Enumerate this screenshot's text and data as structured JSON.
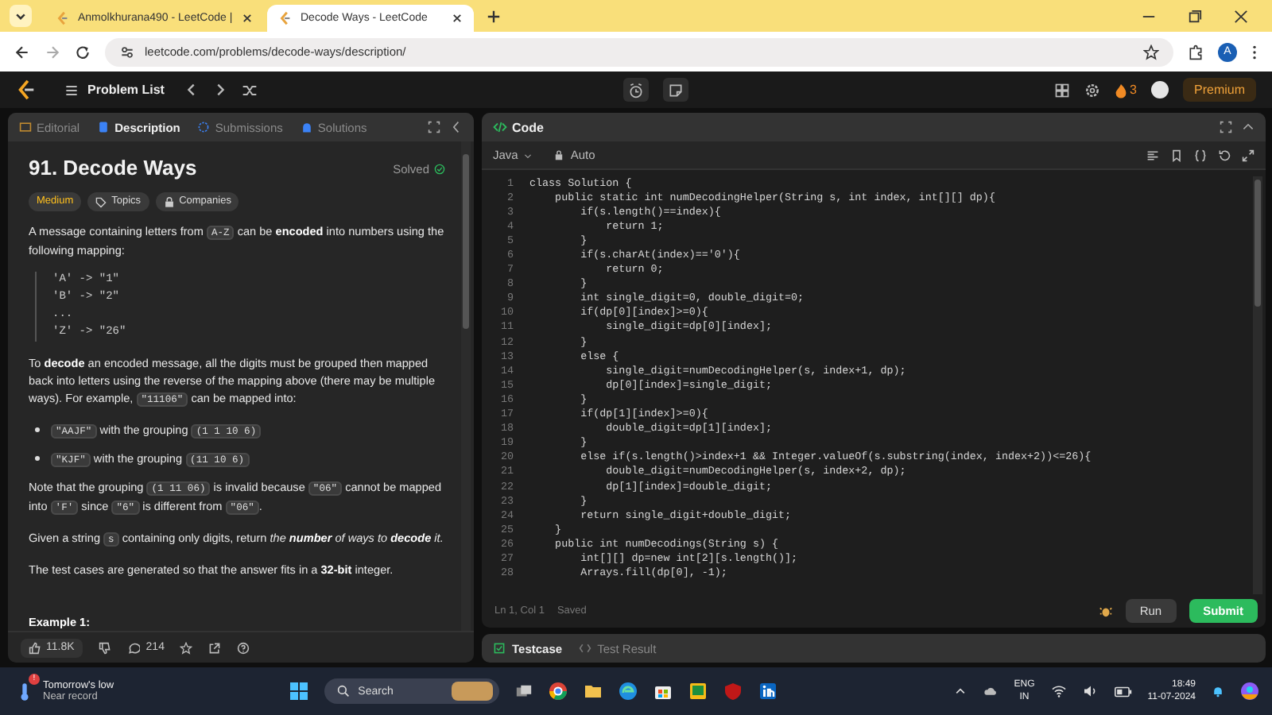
{
  "browser": {
    "tabs": [
      {
        "title": "Anmolkhurana490 - LeetCode |",
        "selected": false
      },
      {
        "title": "Decode Ways - LeetCode",
        "selected": true
      }
    ],
    "url": "leetcode.com/problems/decode-ways/description/",
    "profile_initial": "A"
  },
  "nav": {
    "problem_list": "Problem List",
    "streak": "3",
    "premium": "Premium"
  },
  "left_tabs": [
    {
      "label": "Editorial",
      "selected": false
    },
    {
      "label": "Description",
      "selected": true
    },
    {
      "label": "Submissions",
      "selected": false
    },
    {
      "label": "Solutions",
      "selected": false
    }
  ],
  "problem": {
    "title": "91. Decode Ways",
    "status": "Solved",
    "difficulty": "Medium",
    "tags": [
      "Topics",
      "Companies"
    ],
    "blocks": [
      {
        "kind": "paragraph",
        "parts": [
          {
            "text": "A message containing letters from ",
            "kind": "text"
          },
          {
            "text": "A-Z",
            "kind": "code"
          },
          {
            "text": " can be ",
            "kind": "text"
          },
          {
            "text": "encoded",
            "kind": "bold"
          },
          {
            "text": " into numbers using the following mapping:",
            "kind": "text"
          }
        ]
      },
      {
        "kind": "pre",
        "lines": [
          "'A' -> \"1\"",
          "'B' -> \"2\"",
          "...",
          "'Z' -> \"26\""
        ]
      },
      {
        "kind": "paragraph",
        "parts": [
          {
            "text": "To ",
            "kind": "text"
          },
          {
            "text": "decode",
            "kind": "bold"
          },
          {
            "text": " an encoded message, all the digits must be grouped then mapped back into letters using the reverse of the mapping above (there may be multiple ways). For example, ",
            "kind": "text"
          },
          {
            "text": "\"11106\"",
            "kind": "code"
          },
          {
            "text": " can be mapped into:",
            "kind": "text"
          }
        ]
      },
      {
        "kind": "bullets",
        "items": [
          [
            {
              "text": "\"AAJF\"",
              "kind": "code"
            },
            {
              "text": " with the grouping ",
              "kind": "text"
            },
            {
              "text": "(1 1 10 6)",
              "kind": "code"
            }
          ],
          [
            {
              "text": "\"KJF\"",
              "kind": "code"
            },
            {
              "text": " with the grouping ",
              "kind": "text"
            },
            {
              "text": "(11 10 6)",
              "kind": "code"
            }
          ]
        ]
      },
      {
        "kind": "paragraph",
        "parts": [
          {
            "text": "Note that the grouping ",
            "kind": "text"
          },
          {
            "text": "(1 11 06)",
            "kind": "code"
          },
          {
            "text": " is invalid because ",
            "kind": "text"
          },
          {
            "text": "\"06\"",
            "kind": "code"
          },
          {
            "text": " cannot be mapped into ",
            "kind": "text"
          },
          {
            "text": "'F'",
            "kind": "code"
          },
          {
            "text": " since ",
            "kind": "text"
          },
          {
            "text": "\"6\"",
            "kind": "code"
          },
          {
            "text": " is different from ",
            "kind": "text"
          },
          {
            "text": "\"06\"",
            "kind": "code"
          },
          {
            "text": ".",
            "kind": "text"
          }
        ]
      },
      {
        "kind": "paragraph",
        "parts": [
          {
            "text": "Given a string ",
            "kind": "text"
          },
          {
            "text": "s",
            "kind": "code"
          },
          {
            "text": " containing only digits, return ",
            "kind": "text"
          },
          {
            "text": "the ",
            "kind": "italic"
          },
          {
            "text": "number",
            "kind": "bolditalic"
          },
          {
            "text": " of ways to ",
            "kind": "italic"
          },
          {
            "text": "decode",
            "kind": "bolditalic"
          },
          {
            "text": " it.",
            "kind": "italic"
          }
        ]
      },
      {
        "kind": "paragraph",
        "parts": [
          {
            "text": "The test cases are generated so that the answer fits in a ",
            "kind": "text"
          },
          {
            "text": "32-bit",
            "kind": "bold"
          },
          {
            "text": " integer.",
            "kind": "text"
          }
        ]
      },
      {
        "kind": "heading",
        "text": "Example 1:"
      }
    ]
  },
  "left_footer": {
    "likes": "11.8K",
    "comments": "214"
  },
  "code_panel": {
    "title": "Code",
    "language": "Java",
    "mode": "Auto",
    "lines": [
      {
        "number": "1",
        "text": "class Solution {"
      },
      {
        "number": "2",
        "text": "    public static int numDecodingHelper(String s, int index, int[][] dp){"
      },
      {
        "number": "3",
        "text": "        if(s.length()==index){"
      },
      {
        "number": "4",
        "text": "            return 1;"
      },
      {
        "number": "5",
        "text": "        }"
      },
      {
        "number": "6",
        "text": "        if(s.charAt(index)=='0'){"
      },
      {
        "number": "7",
        "text": "            return 0;"
      },
      {
        "number": "8",
        "text": "        }"
      },
      {
        "number": "9",
        "text": "        int single_digit=0, double_digit=0;"
      },
      {
        "number": "10",
        "text": "        if(dp[0][index]>=0){"
      },
      {
        "number": "11",
        "text": "            single_digit=dp[0][index];"
      },
      {
        "number": "12",
        "text": "        }"
      },
      {
        "number": "13",
        "text": "        else {"
      },
      {
        "number": "14",
        "text": "            single_digit=numDecodingHelper(s, index+1, dp);"
      },
      {
        "number": "15",
        "text": "            dp[0][index]=single_digit;"
      },
      {
        "number": "16",
        "text": "        }"
      },
      {
        "number": "17",
        "text": "        if(dp[1][index]>=0){"
      },
      {
        "number": "18",
        "text": "            double_digit=dp[1][index];"
      },
      {
        "number": "19",
        "text": "        }"
      },
      {
        "number": "20",
        "text": "        else if(s.length()>index+1 && Integer.valueOf(s.substring(index, index+2))<=26){"
      },
      {
        "number": "21",
        "text": "            double_digit=numDecodingHelper(s, index+2, dp);"
      },
      {
        "number": "22",
        "text": "            dp[1][index]=double_digit;"
      },
      {
        "number": "23",
        "text": "        }"
      },
      {
        "number": "24",
        "text": "        return single_digit+double_digit;"
      },
      {
        "number": "25",
        "text": "    }"
      },
      {
        "number": "26",
        "text": "    public int numDecodings(String s) {"
      },
      {
        "number": "27",
        "text": "        int[][] dp=new int[2][s.length()];"
      },
      {
        "number": "28",
        "text": "        Arrays.fill(dp[0], -1);"
      }
    ],
    "cursor": "Ln 1, Col 1",
    "save_state": "Saved",
    "run": "Run",
    "submit": "Submit"
  },
  "bottom_tabs": [
    {
      "label": "Testcase",
      "selected": true
    },
    {
      "label": "Test Result",
      "selected": false
    }
  ],
  "taskbar": {
    "alert_badge": "!",
    "weather_title": "Tomorrow's low",
    "weather_sub": "Near record",
    "search": "Search",
    "lang": "ENG",
    "region": "IN",
    "time": "18:49",
    "date": "11-07-2024"
  }
}
